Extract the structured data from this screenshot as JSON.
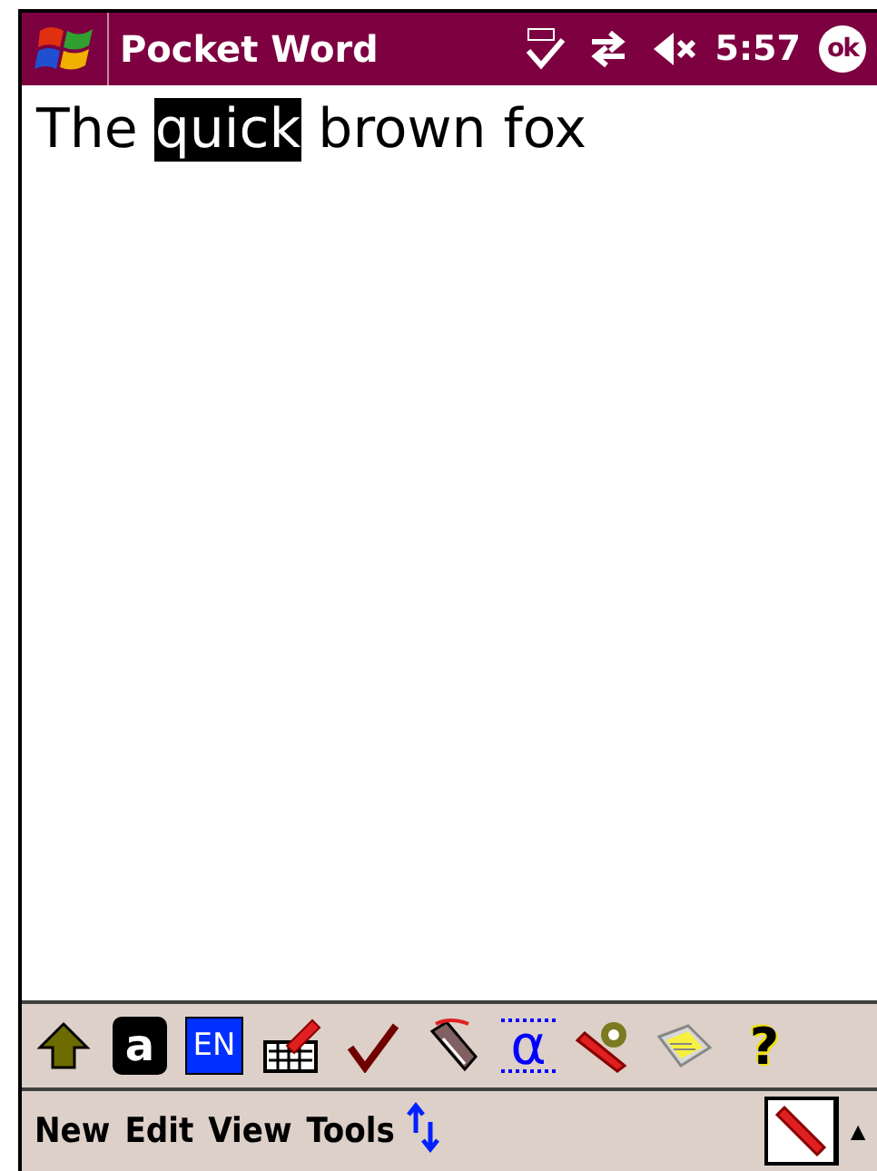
{
  "title_bar": {
    "title": "Pocket Word",
    "time": "5:57",
    "ok": "ok",
    "sound_muted": true
  },
  "document": {
    "segments": [
      {
        "text": "The ",
        "selected": false
      },
      {
        "text": "quick",
        "selected": true
      },
      {
        "text": " brown fox",
        "selected": false
      }
    ]
  },
  "toolbar": [
    {
      "kind": "shift"
    },
    {
      "kind": "letter",
      "label": "a"
    },
    {
      "kind": "language",
      "label": "EN"
    },
    {
      "kind": "keyboard"
    },
    {
      "kind": "spellcheck"
    },
    {
      "kind": "eraser"
    },
    {
      "kind": "symbol",
      "label": "α"
    },
    {
      "kind": "pen"
    },
    {
      "kind": "notes"
    },
    {
      "kind": "help",
      "label": "?"
    }
  ],
  "menu_bar": {
    "items": [
      "New",
      "Edit",
      "View",
      "Tools"
    ],
    "input_panel": {
      "selected": true
    },
    "caret": "▲"
  }
}
